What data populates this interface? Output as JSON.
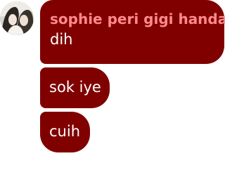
{
  "conversation": {
    "sender_name": "sophie peri gigi handal",
    "messages": [
      {
        "text": "dih"
      },
      {
        "text": "sok iye"
      },
      {
        "text": "cuih"
      }
    ]
  },
  "colors": {
    "bubble": "#800000",
    "sender_name": "#ff8a8a",
    "message_text": "#ffffff"
  }
}
